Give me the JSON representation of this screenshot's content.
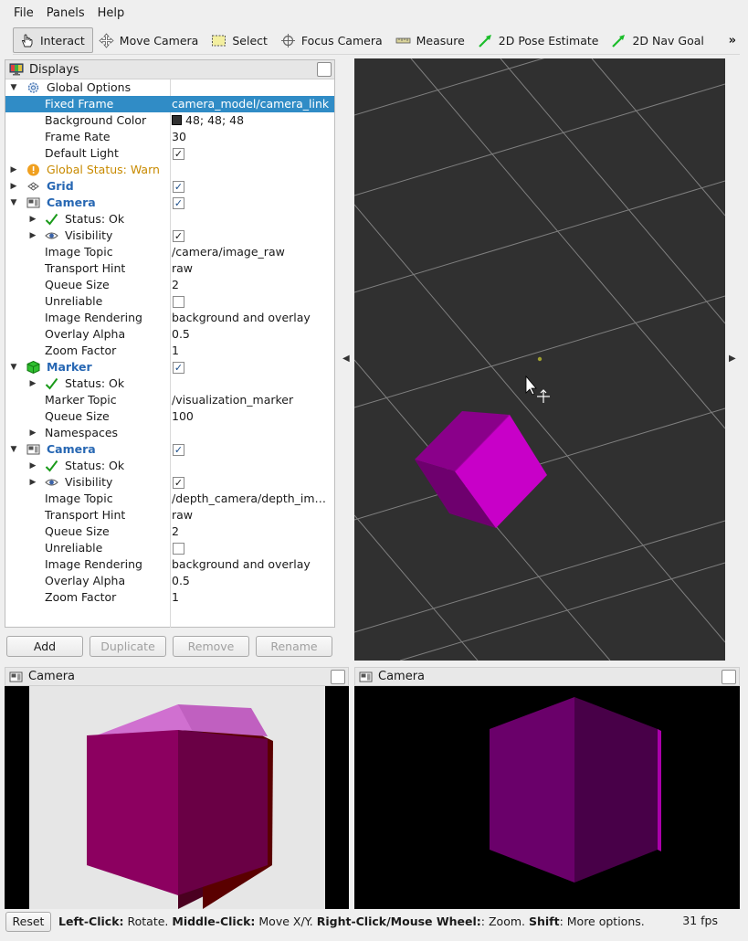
{
  "menubar": {
    "file": "File",
    "panels": "Panels",
    "help": "Help"
  },
  "toolbar": {
    "interact": "Interact",
    "move_camera": "Move Camera",
    "select": "Select",
    "focus_camera": "Focus Camera",
    "measure": "Measure",
    "pose_estimate": "2D Pose Estimate",
    "nav_goal": "2D Nav Goal",
    "more": "»"
  },
  "displays": {
    "title": "Displays",
    "rows": [
      {
        "label": "Global Options"
      },
      {
        "label": "Fixed Frame",
        "value": "camera_model/camera_link"
      },
      {
        "label": "Background Color",
        "value": "48; 48; 48"
      },
      {
        "label": "Frame Rate",
        "value": "30"
      },
      {
        "label": "Default Light",
        "value": "✓"
      },
      {
        "label": "Global Status: Warn"
      },
      {
        "label": "Grid",
        "value": "✓"
      },
      {
        "label": "Camera",
        "value": "✓"
      },
      {
        "label": "Status: Ok"
      },
      {
        "label": "Visibility",
        "value": "✓"
      },
      {
        "label": "Image Topic",
        "value": "/camera/image_raw"
      },
      {
        "label": "Transport Hint",
        "value": "raw"
      },
      {
        "label": "Queue Size",
        "value": "2"
      },
      {
        "label": "Unreliable",
        "value": ""
      },
      {
        "label": "Image Rendering",
        "value": "background and overlay"
      },
      {
        "label": "Overlay Alpha",
        "value": "0.5"
      },
      {
        "label": "Zoom Factor",
        "value": "1"
      },
      {
        "label": "Marker",
        "value": "✓"
      },
      {
        "label": "Status: Ok"
      },
      {
        "label": "Marker Topic",
        "value": "/visualization_marker"
      },
      {
        "label": "Queue Size",
        "value": "100"
      },
      {
        "label": "Namespaces"
      },
      {
        "label": "Camera",
        "value": "✓"
      },
      {
        "label": "Status: Ok"
      },
      {
        "label": "Visibility",
        "value": "✓"
      },
      {
        "label": "Image Topic",
        "value": "/depth_camera/depth_image"
      },
      {
        "label": "Transport Hint",
        "value": "raw"
      },
      {
        "label": "Queue Size",
        "value": "2"
      },
      {
        "label": "Unreliable",
        "value": ""
      },
      {
        "label": "Image Rendering",
        "value": "background and overlay"
      },
      {
        "label": "Overlay Alpha",
        "value": "0.5"
      },
      {
        "label": "Zoom Factor",
        "value": "1"
      }
    ],
    "buttons": {
      "add": "Add",
      "duplicate": "Duplicate",
      "remove": "Remove",
      "rename": "Rename"
    }
  },
  "camera_panels": {
    "left_title": "Camera",
    "right_title": "Camera"
  },
  "statusbar": {
    "reset": "Reset",
    "left_click": "Left-Click:",
    "rotate": " Rotate. ",
    "middle_click": "Middle-Click:",
    "move": " Move X/Y. ",
    "right_click": "Right-Click/Mouse Wheel:",
    "zoom": ": Zoom. ",
    "shift": "Shift",
    "more": ": More options.",
    "fps": "31 fps"
  },
  "colors": {
    "selection": "#308cc6",
    "view_bg": "#303030",
    "marker": "#cc00cc",
    "link_blue": "#2767b3",
    "warn": "#c88a00"
  }
}
